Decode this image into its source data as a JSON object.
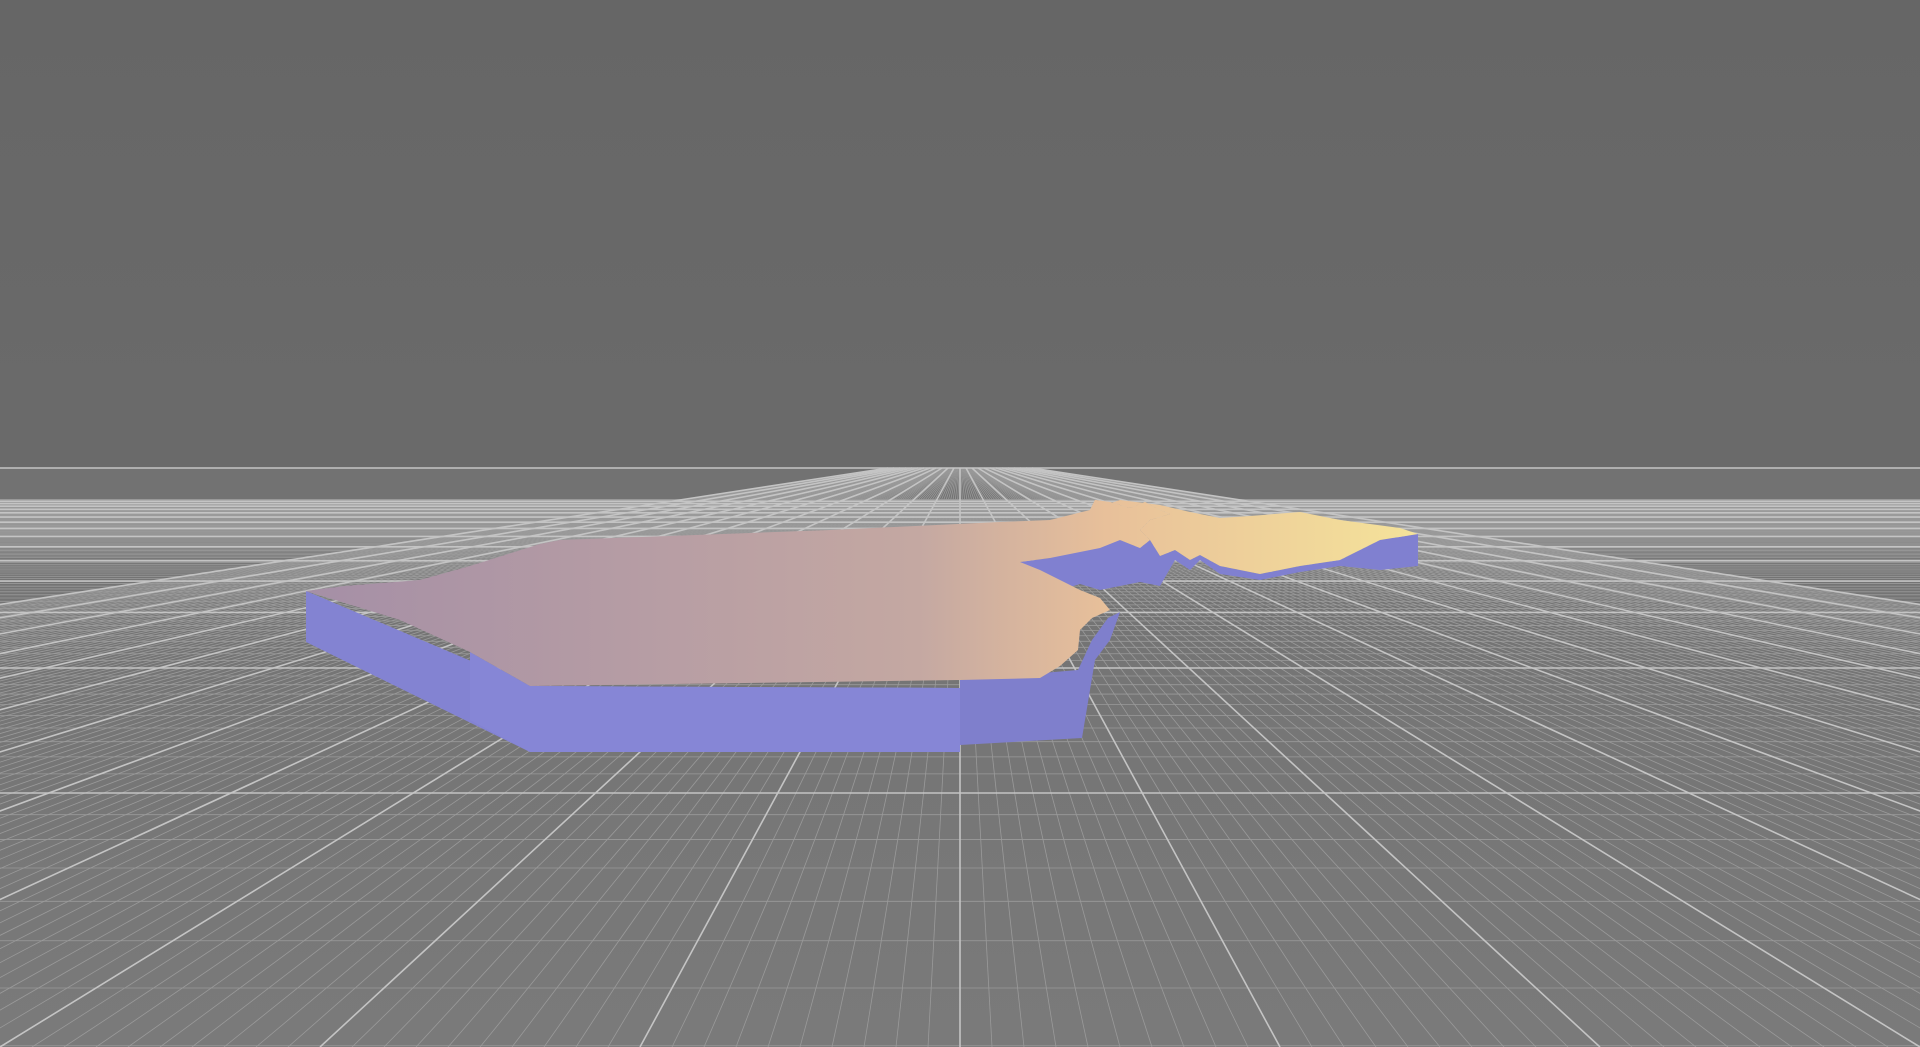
{
  "viewport": {
    "background_color": "#6b6b6b",
    "grid_minor_color": "#9a9a9a",
    "grid_major_color": "#c4c4c4",
    "floor_color": "#777777"
  },
  "model": {
    "top_color_left": "#a58fa6",
    "top_color_right": "#f5e39a",
    "side_color": "#8585d4",
    "side_shadow_color": "#7373c4"
  }
}
